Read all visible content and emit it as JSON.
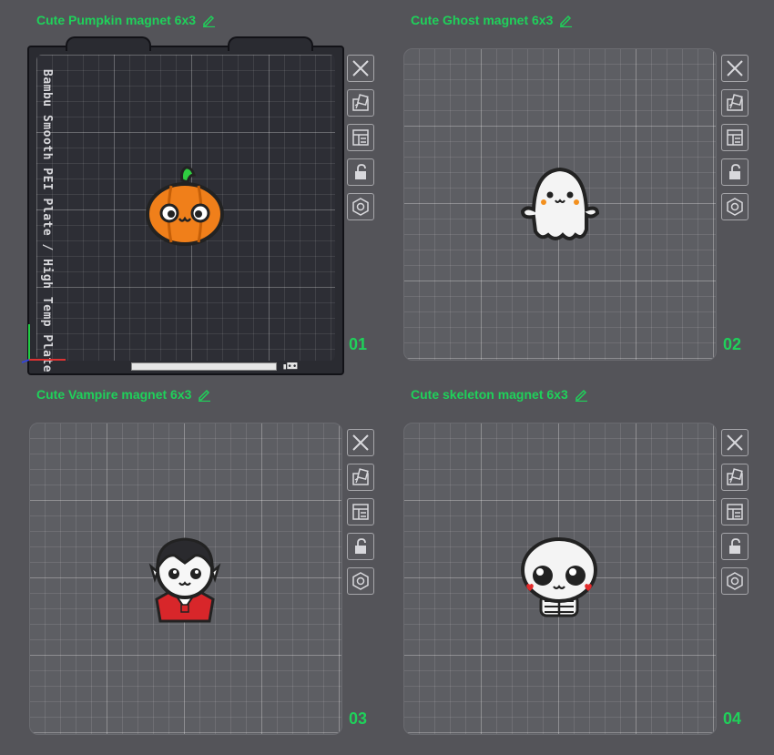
{
  "plates": [
    {
      "title": "Cute Pumpkin magnet 6x3",
      "number": "01",
      "model": "pumpkin",
      "active": true,
      "plate_text": "Bambu Smooth PEI Plate / High Temp Plate"
    },
    {
      "title": "Cute Ghost magnet 6x3",
      "number": "02",
      "model": "ghost",
      "active": false
    },
    {
      "title": "Cute Vampire magnet 6x3",
      "number": "03",
      "model": "vampire",
      "active": false
    },
    {
      "title": "Cute skeleton magnet 6x3",
      "number": "04",
      "model": "skeleton",
      "active": false
    }
  ],
  "toolbar_icons": [
    "close-icon",
    "auto-orient-icon",
    "arrange-icon",
    "lock-icon",
    "plate-settings-icon"
  ],
  "colors": {
    "label_green": "#1fd15a",
    "pumpkin_orange": "#f07f1a",
    "stem_green": "#2fcc40",
    "vampire_red": "#d8262a"
  }
}
